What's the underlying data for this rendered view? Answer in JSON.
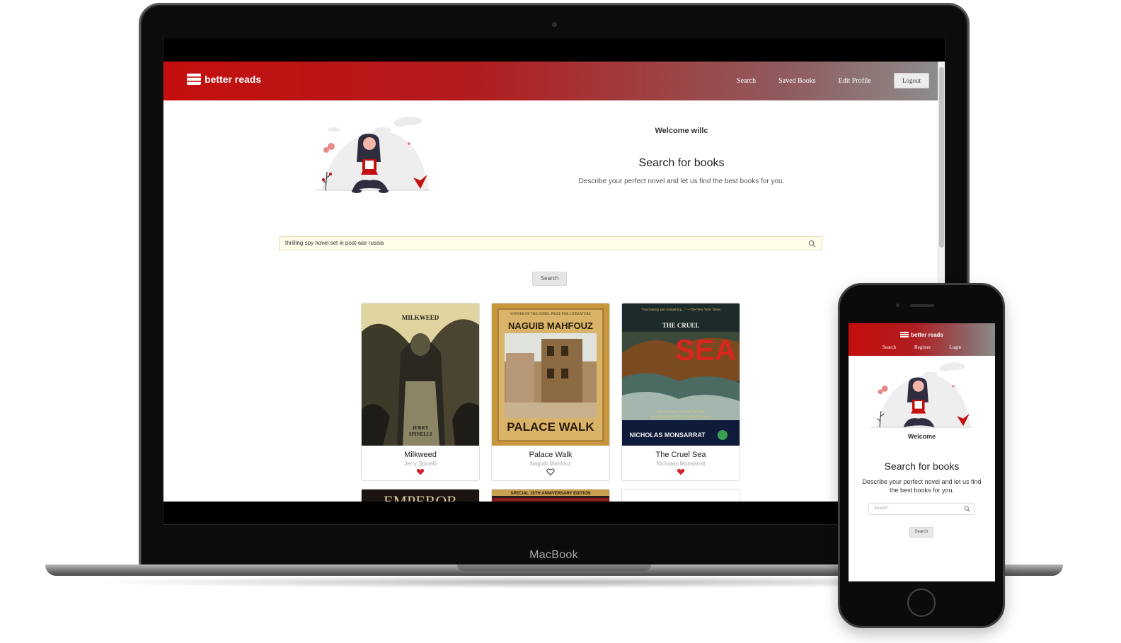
{
  "laptop": {
    "brand_label": "MacBook"
  },
  "site": {
    "brand": "better reads",
    "nav": {
      "search": "Search",
      "saved_books": "Saved Books",
      "edit_profile": "Edit Profile",
      "logout": "Logout"
    },
    "welcome": "Welcome willc",
    "title": "Search for books",
    "description": "Describe your perfect novel and let us find the best books for you.",
    "search": {
      "value": "thrilling spy novel set in post-war russia"
    },
    "search_button": "Search",
    "books": [
      {
        "title": "Milkweed",
        "author": "Jerry Spinelli",
        "saved": true,
        "cover_text": [
          "MILKWEED",
          "JERRY",
          "SPINELLI"
        ]
      },
      {
        "title": "Palace Walk",
        "author": "Naguib Mahfouz",
        "saved": false,
        "cover_text": [
          "WINNER OF THE NOBEL PRIZE FOR LITERATURE",
          "NAGUIB MAHFOUZ",
          "PALACE WALK"
        ]
      },
      {
        "title": "The Cruel Sea",
        "author": "Nicholas Monsarrat",
        "saved": true,
        "cover_text": [
          "\"Fascinating and compelling...\" —The New York Times",
          "THE  CRUEL",
          "SEA",
          "THE CLASSIC NOVEL OF THE",
          "NORTH ATLANTIC IN WORLD WAR II",
          "NICHOLAS MONSARRAT"
        ]
      }
    ],
    "partial_covers": [
      "EMPEROR",
      "SPECIAL 15TH ANNIVERSARY EDITION"
    ]
  },
  "mobile": {
    "brand": "better reads",
    "nav": {
      "search": "Search",
      "register": "Register",
      "login": "Login"
    },
    "welcome": "Welcome",
    "title": "Search for books",
    "description": "Describe your perfect novel and let us find the best books for you.",
    "search_placeholder": "Search..",
    "search_button": "Search"
  },
  "colors": {
    "brand_red": "#c50e0e",
    "heart_red": "#d0232a"
  }
}
